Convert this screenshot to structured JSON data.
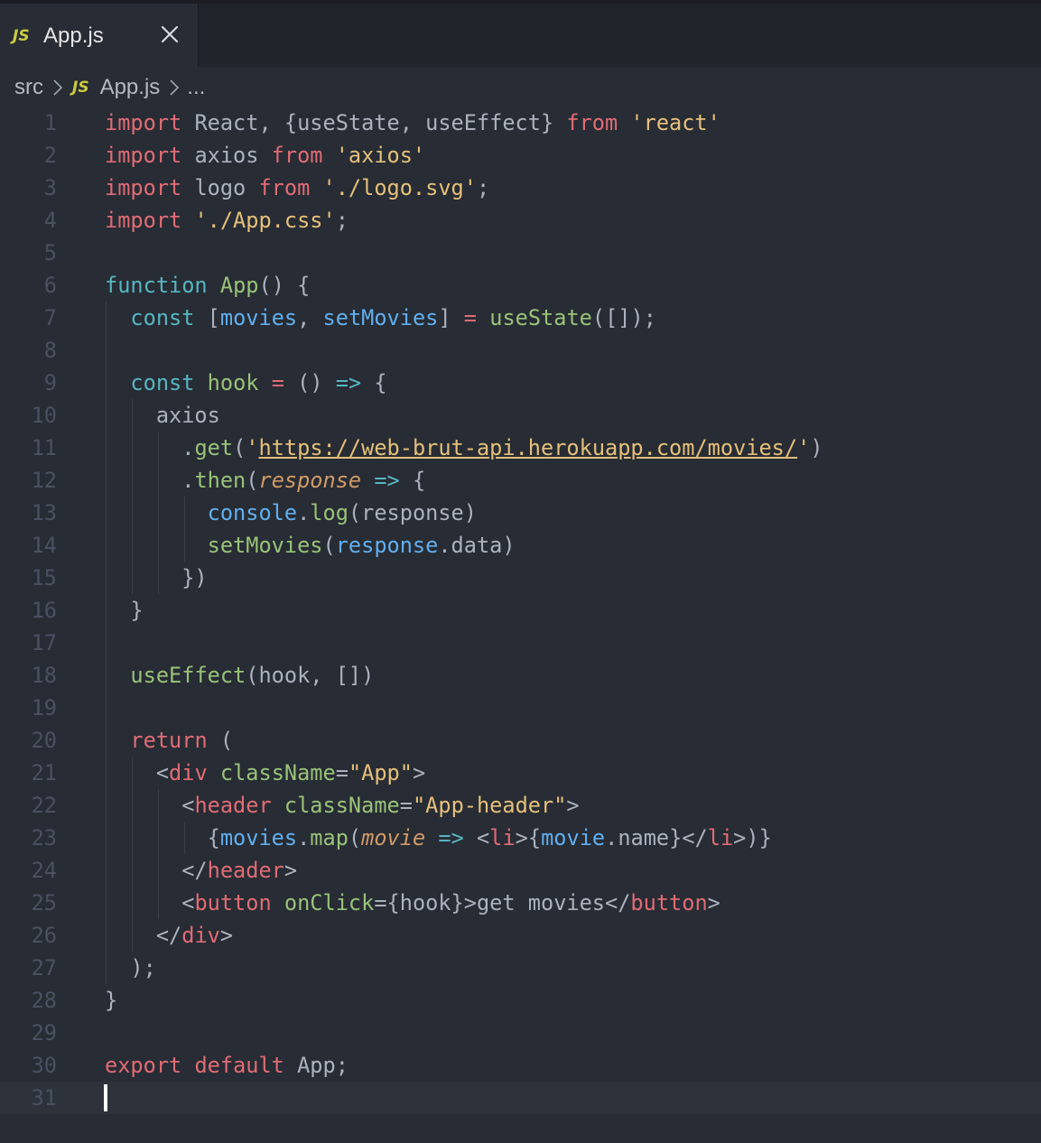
{
  "tab": {
    "icon_label": "JS",
    "file_name": "App.js"
  },
  "breadcrumb": {
    "folder": "src",
    "file_icon_label": "JS",
    "file": "App.js",
    "more": "..."
  },
  "colors": {
    "background": "#282c34",
    "tab_bar": "#21252b",
    "keyword": "#e06c75",
    "function": "#98c379",
    "variable": "#61afef",
    "string": "#e5c07b",
    "line_number": "#495162"
  },
  "cursor_line": 31,
  "lines": [
    [
      {
        "t": "import",
        "c": "kw"
      },
      {
        "t": " React, {useState, useEffect} ",
        "c": "pl"
      },
      {
        "t": "from",
        "c": "kw"
      },
      {
        "t": " 'react'",
        "c": "str"
      }
    ],
    [
      {
        "t": "import",
        "c": "kw"
      },
      {
        "t": " axios ",
        "c": "pl"
      },
      {
        "t": "from",
        "c": "kw"
      },
      {
        "t": " 'axios'",
        "c": "str"
      }
    ],
    [
      {
        "t": "import",
        "c": "kw"
      },
      {
        "t": " logo ",
        "c": "pl"
      },
      {
        "t": "from",
        "c": "kw"
      },
      {
        "t": " './logo.svg'",
        "c": "str"
      },
      {
        "t": ";",
        "c": "pl"
      }
    ],
    [
      {
        "t": "import",
        "c": "kw"
      },
      {
        "t": " './App.css'",
        "c": "str"
      },
      {
        "t": ";",
        "c": "pl"
      }
    ],
    [],
    [
      {
        "t": "function",
        "c": "cy"
      },
      {
        "t": " ",
        "c": "pl"
      },
      {
        "t": "App",
        "c": "fn"
      },
      {
        "t": "() {",
        "c": "pl"
      }
    ],
    [
      {
        "t": "  ",
        "c": "pl"
      },
      {
        "t": "const",
        "c": "cy"
      },
      {
        "t": " [",
        "c": "pl"
      },
      {
        "t": "movies",
        "c": "var"
      },
      {
        "t": ", ",
        "c": "pl"
      },
      {
        "t": "setMovies",
        "c": "var"
      },
      {
        "t": "] ",
        "c": "pl"
      },
      {
        "t": "=",
        "c": "kw"
      },
      {
        "t": " ",
        "c": "pl"
      },
      {
        "t": "useState",
        "c": "fn"
      },
      {
        "t": "([]);",
        "c": "pl"
      }
    ],
    [],
    [
      {
        "t": "  ",
        "c": "pl"
      },
      {
        "t": "const",
        "c": "cy"
      },
      {
        "t": " ",
        "c": "pl"
      },
      {
        "t": "hook",
        "c": "fn"
      },
      {
        "t": " ",
        "c": "pl"
      },
      {
        "t": "=",
        "c": "kw"
      },
      {
        "t": " () ",
        "c": "pl"
      },
      {
        "t": "=>",
        "c": "cy"
      },
      {
        "t": " {",
        "c": "pl"
      }
    ],
    [
      {
        "t": "    axios",
        "c": "pl"
      }
    ],
    [
      {
        "t": "      .",
        "c": "pl"
      },
      {
        "t": "get",
        "c": "fn"
      },
      {
        "t": "(",
        "c": "pl"
      },
      {
        "t": "'",
        "c": "str"
      },
      {
        "t": "https://web-brut-api.herokuapp.com/movies/",
        "c": "url"
      },
      {
        "t": "'",
        "c": "str"
      },
      {
        "t": ")",
        "c": "pl"
      }
    ],
    [
      {
        "t": "      .",
        "c": "pl"
      },
      {
        "t": "then",
        "c": "fn"
      },
      {
        "t": "(",
        "c": "pl"
      },
      {
        "t": "response",
        "c": "par"
      },
      {
        "t": " ",
        "c": "pl"
      },
      {
        "t": "=>",
        "c": "cy"
      },
      {
        "t": " {",
        "c": "pl"
      }
    ],
    [
      {
        "t": "        ",
        "c": "pl"
      },
      {
        "t": "console",
        "c": "var"
      },
      {
        "t": ".",
        "c": "pl"
      },
      {
        "t": "log",
        "c": "fn"
      },
      {
        "t": "(response)",
        "c": "pl"
      }
    ],
    [
      {
        "t": "        ",
        "c": "pl"
      },
      {
        "t": "setMovies",
        "c": "fn"
      },
      {
        "t": "(",
        "c": "pl"
      },
      {
        "t": "response",
        "c": "var"
      },
      {
        "t": ".data)",
        "c": "pl"
      }
    ],
    [
      {
        "t": "      })",
        "c": "pl"
      }
    ],
    [
      {
        "t": "  }",
        "c": "pl"
      }
    ],
    [],
    [
      {
        "t": "  ",
        "c": "pl"
      },
      {
        "t": "useEffect",
        "c": "fn"
      },
      {
        "t": "(hook, [])",
        "c": "pl"
      }
    ],
    [],
    [
      {
        "t": "  ",
        "c": "pl"
      },
      {
        "t": "return",
        "c": "kw"
      },
      {
        "t": " (",
        "c": "pl"
      }
    ],
    [
      {
        "t": "    <",
        "c": "pl"
      },
      {
        "t": "div",
        "c": "kw"
      },
      {
        "t": " ",
        "c": "pl"
      },
      {
        "t": "className",
        "c": "fn"
      },
      {
        "t": "=",
        "c": "pl"
      },
      {
        "t": "\"App\"",
        "c": "str"
      },
      {
        "t": ">",
        "c": "pl"
      }
    ],
    [
      {
        "t": "      <",
        "c": "pl"
      },
      {
        "t": "header",
        "c": "kw"
      },
      {
        "t": " ",
        "c": "pl"
      },
      {
        "t": "className",
        "c": "fn"
      },
      {
        "t": "=",
        "c": "pl"
      },
      {
        "t": "\"App-header\"",
        "c": "str"
      },
      {
        "t": ">",
        "c": "pl"
      }
    ],
    [
      {
        "t": "        {",
        "c": "pl"
      },
      {
        "t": "movies",
        "c": "var"
      },
      {
        "t": ".",
        "c": "pl"
      },
      {
        "t": "map",
        "c": "fn"
      },
      {
        "t": "(",
        "c": "pl"
      },
      {
        "t": "movie",
        "c": "par"
      },
      {
        "t": " ",
        "c": "pl"
      },
      {
        "t": "=>",
        "c": "cy"
      },
      {
        "t": " <",
        "c": "pl"
      },
      {
        "t": "li",
        "c": "kw"
      },
      {
        "t": ">{",
        "c": "pl"
      },
      {
        "t": "movie",
        "c": "var"
      },
      {
        "t": ".name}</",
        "c": "pl"
      },
      {
        "t": "li",
        "c": "kw"
      },
      {
        "t": ">)}",
        "c": "pl"
      }
    ],
    [
      {
        "t": "      </",
        "c": "pl"
      },
      {
        "t": "header",
        "c": "kw"
      },
      {
        "t": ">",
        "c": "pl"
      }
    ],
    [
      {
        "t": "      <",
        "c": "pl"
      },
      {
        "t": "button",
        "c": "kw"
      },
      {
        "t": " ",
        "c": "pl"
      },
      {
        "t": "onClick",
        "c": "fn"
      },
      {
        "t": "={hook}>get movies</",
        "c": "pl"
      },
      {
        "t": "button",
        "c": "kw"
      },
      {
        "t": ">",
        "c": "pl"
      }
    ],
    [
      {
        "t": "    </",
        "c": "pl"
      },
      {
        "t": "div",
        "c": "kw"
      },
      {
        "t": ">",
        "c": "pl"
      }
    ],
    [
      {
        "t": "  );",
        "c": "pl"
      }
    ],
    [
      {
        "t": "}",
        "c": "pl"
      }
    ],
    [],
    [
      {
        "t": "export",
        "c": "kw"
      },
      {
        "t": " ",
        "c": "pl"
      },
      {
        "t": "default",
        "c": "kw"
      },
      {
        "t": " App;",
        "c": "pl"
      }
    ],
    []
  ]
}
